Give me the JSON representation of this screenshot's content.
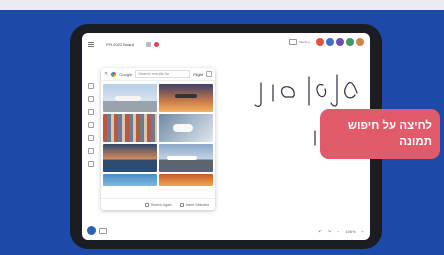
{
  "colors": {
    "background_blue": "#1d4aa8",
    "callout_pink": "#e05a6a",
    "tablet_bezel": "#1b1d22",
    "avatar_colors": [
      "#e2533f",
      "#3e6fc7",
      "#6b4fb0",
      "#3a9a6a",
      "#d0864a"
    ]
  },
  "app": {
    "doc_title": "P.R.2022 Board",
    "top_right_label": "Meeting",
    "zoom": "100%"
  },
  "search_panel": {
    "engine": "Google",
    "placeholder": "Search results for",
    "query": "Flight",
    "footer": {
      "search_again": "Search Again",
      "insert_selected": "Insert Selected"
    }
  },
  "canvas": {
    "handwriting_lines": [
      "לאן הכי",
      "לי"
    ]
  },
  "callout": {
    "line1": "לחיצה על חיפוש",
    "line2": "תמונה"
  },
  "icons": {
    "left_toolbar": [
      "pointer-icon",
      "pen-icon",
      "shapes-icon",
      "text-icon",
      "image-icon",
      "eraser-icon",
      "more-icon"
    ]
  }
}
